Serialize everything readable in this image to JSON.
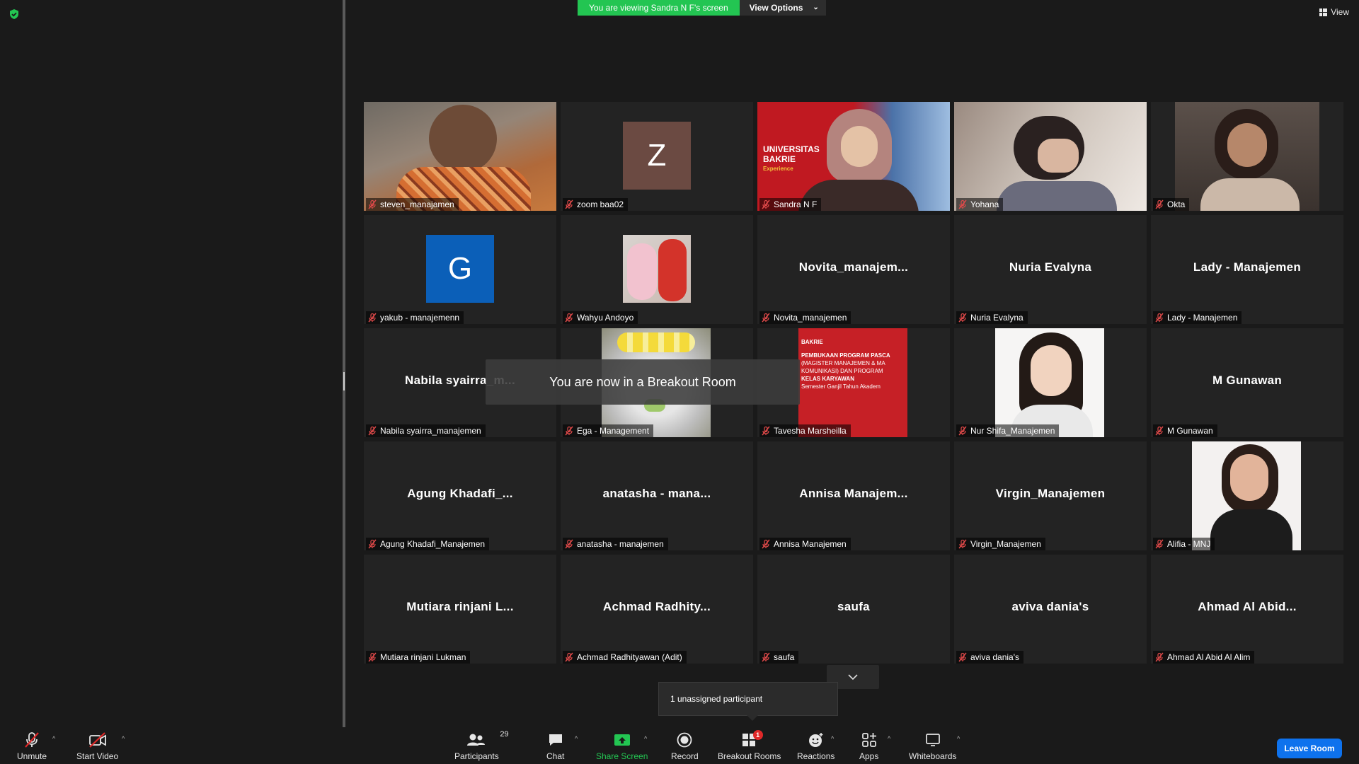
{
  "banner": {
    "message": "You are viewing Sandra N F's screen",
    "view_options": "View Options"
  },
  "view_button": "View",
  "tiles": [
    {
      "label": "steven_manajamen",
      "display": "photo",
      "active": false
    },
    {
      "label": "zoom baa02",
      "display": "avatar",
      "initial": "Z",
      "avatar_color": "#6b4a42",
      "active": false
    },
    {
      "label": "Sandra N F",
      "display": "photo",
      "active": true
    },
    {
      "label": "Yohana",
      "display": "photo",
      "active": false
    },
    {
      "label": "Okta",
      "display": "photo",
      "active": false
    },
    {
      "label": "yakub - manajemenn",
      "display": "avatar",
      "initial": "G",
      "avatar_color": "#0b5fb8",
      "active": false
    },
    {
      "label": "Wahyu Andoyo",
      "display": "photo",
      "active": false
    },
    {
      "label": "Novita_manajemen",
      "display": "name",
      "big_name": "Novita_manajem...",
      "active": false
    },
    {
      "label": "Nuria Evalyna",
      "display": "name",
      "big_name": "Nuria Evalyna",
      "active": false
    },
    {
      "label": "Lady - Manajemen",
      "display": "name",
      "big_name": "Lady - Manajemen",
      "active": false
    },
    {
      "label": "Nabila syairra_manajemen",
      "display": "name",
      "big_name": "Nabila syairra_m...",
      "active": false
    },
    {
      "label": "Ega - Management",
      "display": "photo",
      "active": false
    },
    {
      "label": "Tavesha Marsheilla",
      "display": "photo",
      "active": false
    },
    {
      "label": "Nur Shifa_Manajemen",
      "display": "photo",
      "active": false
    },
    {
      "label": "M Gunawan",
      "display": "name",
      "big_name": "M Gunawan",
      "active": false
    },
    {
      "label": "Agung Khadafi_Manajemen",
      "display": "name",
      "big_name": "Agung Khadafi_...",
      "active": false
    },
    {
      "label": "anatasha - manajemen",
      "display": "name",
      "big_name": "anatasha - mana...",
      "active": false
    },
    {
      "label": "Annisa Manajemen",
      "display": "name",
      "big_name": "Annisa Manajem...",
      "active": false
    },
    {
      "label": "Virgin_Manajemen",
      "display": "name",
      "big_name": "Virgin_Manajemen",
      "active": false
    },
    {
      "label": "Alifia - MNJ",
      "display": "photo",
      "active": false
    },
    {
      "label": "Mutiara rinjani Lukman",
      "display": "name",
      "big_name": "Mutiara rinjani L...",
      "active": false
    },
    {
      "label": "Achmad Radhityawan (Adit)",
      "display": "name",
      "big_name": "Achmad Radhity...",
      "active": false
    },
    {
      "label": "saufa",
      "display": "name",
      "big_name": "saufa",
      "active": false
    },
    {
      "label": "aviva dania's",
      "display": "name",
      "big_name": "aviva dania's",
      "active": false
    },
    {
      "label": "Ahmad Al Abid Al Alim",
      "display": "name",
      "big_name": "Ahmad Al Abid...",
      "active": false
    }
  ],
  "sandra_slide": {
    "line1": "UNIVERSITAS",
    "line2": "BAKRIE",
    "line3": "Experience"
  },
  "tavesha_slide": {
    "brand": "BAKRIE",
    "title": "PEMBUKAAN PROGRAM PASCA",
    "sub1": "(MAGISTER MANAJEMEN & MA",
    "sub2": "KOMUNIKASI) DAN PROGRAM",
    "sub3": "KELAS KARYAWAN",
    "sub4": "Semester Ganjil Tahun Akadem"
  },
  "toast": "You are now in a Breakout Room",
  "unassigned": "1 unassigned participant",
  "toolbar": {
    "unmute": "Unmute",
    "start_video": "Start Video",
    "participants": "Participants",
    "participants_count": "29",
    "chat": "Chat",
    "share_screen": "Share Screen",
    "record": "Record",
    "breakout_rooms": "Breakout Rooms",
    "breakout_badge": "1",
    "reactions": "Reactions",
    "apps": "Apps",
    "whiteboards": "Whiteboards",
    "leave_room": "Leave Room"
  },
  "colors": {
    "green": "#23c552",
    "active_border": "#f3e336",
    "leave": "#0e72ed",
    "badge": "#e02828"
  }
}
